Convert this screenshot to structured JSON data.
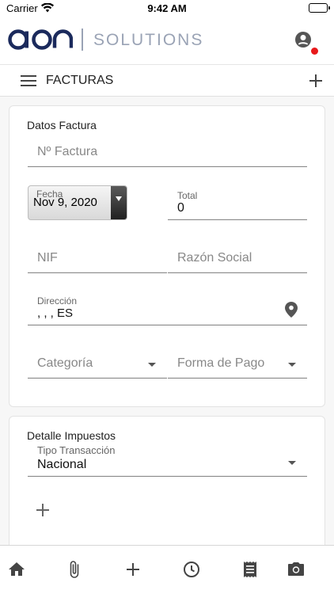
{
  "status_bar": {
    "carrier": "Carrier",
    "time": "9:42 AM"
  },
  "brand": {
    "logo_text": "aon",
    "subtitle": "SOLUTIONS"
  },
  "toolbar": {
    "title": "FACTURAS"
  },
  "datos_factura": {
    "title": "Datos Factura",
    "numero_placeholder": "Nº Factura",
    "fecha_label": "Fecha",
    "fecha_value": "Nov 9, 2020",
    "total_label": "Total",
    "total_value": "0",
    "nif_placeholder": "NIF",
    "razon_social_placeholder": "Razón Social",
    "direccion_label": "Dirección",
    "direccion_value": ", , , ES",
    "categoria_placeholder": "Categoría",
    "forma_pago_placeholder": "Forma de Pago"
  },
  "detalle_impuestos": {
    "title": "Detalle Impuestos",
    "tipo_label": "Tipo Transacción",
    "tipo_value": "Nacional"
  },
  "colors": {
    "brand_dark": "#1b2a5c",
    "brand_grey": "#9aa3b5",
    "notification": "#e8191b"
  },
  "tabbar": {
    "icons": [
      "home-icon",
      "attachment-icon",
      "add-icon",
      "history-icon",
      "receipt-icon",
      "camera-icon"
    ]
  }
}
